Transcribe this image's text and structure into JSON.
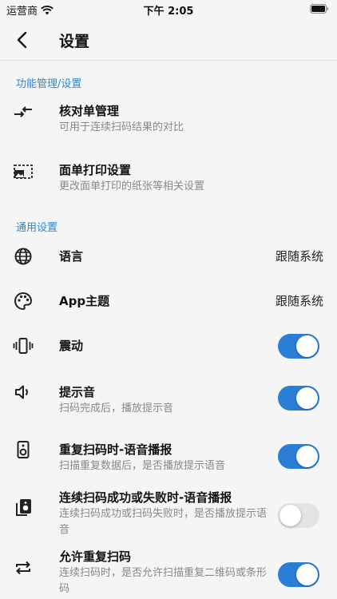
{
  "status_bar": {
    "carrier": "运营商",
    "time": "下午 2:05"
  },
  "nav": {
    "title": "设置"
  },
  "sections": {
    "function": "功能管理/设置",
    "general": "通用设置"
  },
  "items": {
    "checklist": {
      "label": "核对单管理",
      "desc": "可用于连续扫码结果的对比"
    },
    "print": {
      "label": "面单打印设置",
      "desc": "更改面单打印的纸张等相关设置"
    },
    "language": {
      "label": "语言",
      "value": "跟随系统"
    },
    "theme": {
      "label": "App主题",
      "value": "跟随系统"
    },
    "vibration": {
      "label": "震动",
      "enabled": true
    },
    "sound": {
      "label": "提示音",
      "desc": "扫码完成后，播放提示音",
      "enabled": true
    },
    "duplicate_voice": {
      "label": "重复扫码时-语音播报",
      "desc": "扫描重复数据后，是否播放提示语音",
      "enabled": true
    },
    "continuous_voice": {
      "label": "连续扫码成功或失败时-语音播报",
      "desc": "连续扫码成功或扫码失败时，是否播放提示语音",
      "enabled": false
    },
    "allow_duplicate": {
      "label": "允许重复扫码",
      "desc": "连续扫码时，是否允许扫描重复二维码或条形码",
      "enabled": true
    }
  },
  "colors": {
    "accent": "#2a7ed6",
    "section_header": "#2d86d6",
    "toggle_off": "#e3e3e3"
  },
  "icons": {
    "checklist": "compare-arrows-icon",
    "print": "photo-size-select-icon",
    "language": "globe-icon",
    "theme": "palette-icon",
    "vibration": "vibration-icon",
    "sound": "volume-icon",
    "duplicate_voice": "speaker-icon",
    "continuous_voice": "speaker-group-icon",
    "allow_duplicate": "repeat-icon"
  }
}
